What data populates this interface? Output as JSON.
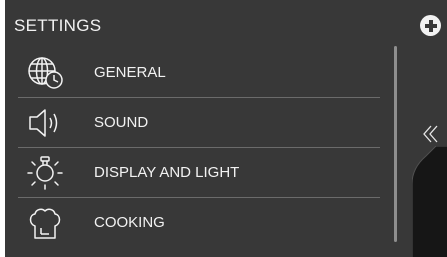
{
  "header": {
    "title": "SETTINGS",
    "add_icon": "plus-circle-icon"
  },
  "menu": {
    "items": [
      {
        "label": "GENERAL",
        "icon": "globe-clock-icon"
      },
      {
        "label": "SOUND",
        "icon": "speaker-icon"
      },
      {
        "label": "DISPLAY AND LIGHT",
        "icon": "lightbulb-icon"
      },
      {
        "label": "COOKING",
        "icon": "chef-hat-icon"
      }
    ]
  },
  "side": {
    "handle_icon": "double-chevron-left-icon"
  },
  "colors": {
    "background": "#383838",
    "text": "#f2f2f2",
    "divider": "#6b6b6b",
    "panel": "#161616"
  }
}
